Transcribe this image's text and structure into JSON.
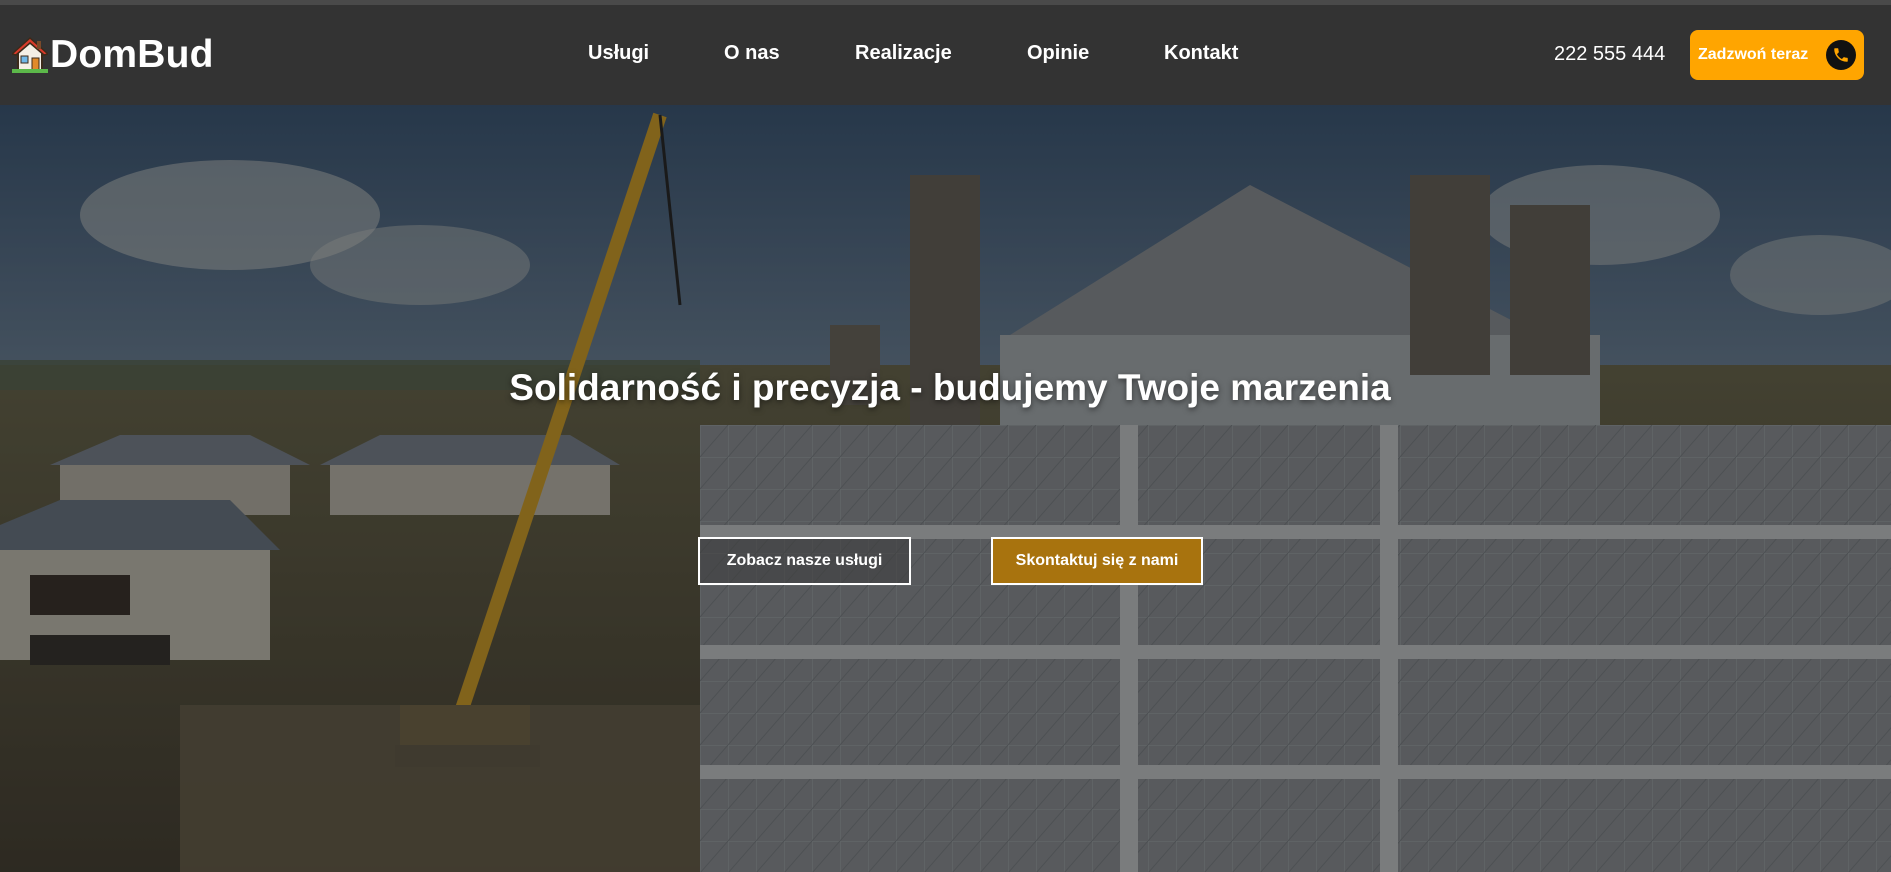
{
  "brand": {
    "name": "DomBud",
    "logo_icon": "house-icon"
  },
  "nav": {
    "items": [
      {
        "label": "Usługi"
      },
      {
        "label": "O nas"
      },
      {
        "label": "Realizacje"
      },
      {
        "label": "Opinie"
      },
      {
        "label": "Kontakt"
      }
    ]
  },
  "contact": {
    "phone": "222 555 444",
    "call_button_label": "Zadzwoń teraz",
    "call_icon": "phone-icon"
  },
  "hero": {
    "title": "Solidarność i precyzja - budujemy Twoje marzenia",
    "primary_button": "Zobacz nasze usługi",
    "secondary_button": "Skontaktuj się z nami"
  },
  "colors": {
    "navbar_bg": "#333333",
    "accent": "#ffa500",
    "secondary_button_bg": "#a8730e",
    "text": "#ffffff"
  }
}
